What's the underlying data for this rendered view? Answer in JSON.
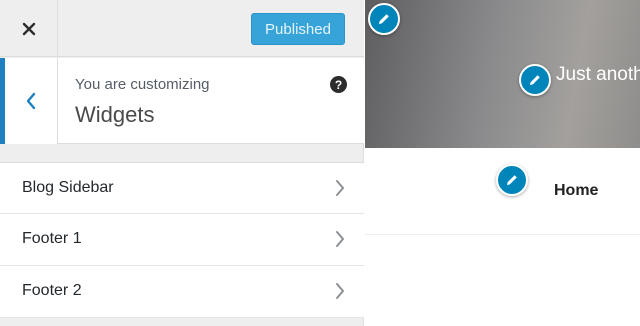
{
  "topbar": {
    "close_icon": "close-icon",
    "publish_label": "Published"
  },
  "section": {
    "customizing_label": "You are customizing",
    "title": "Widgets",
    "back_icon": "chevron-left-icon",
    "help_icon": "help-icon",
    "help_glyph": "?"
  },
  "panels": [
    {
      "label": "Blog Sidebar"
    },
    {
      "label": "Footer 1"
    },
    {
      "label": "Footer 2"
    }
  ],
  "preview": {
    "hero_title": "Just anoth",
    "nav_home": "Home",
    "edit_icon": "pencil-icon"
  },
  "colors": {
    "accent": "#0085ba",
    "publish_bg": "#37a4d9",
    "back_border": "#1e7fc1"
  }
}
